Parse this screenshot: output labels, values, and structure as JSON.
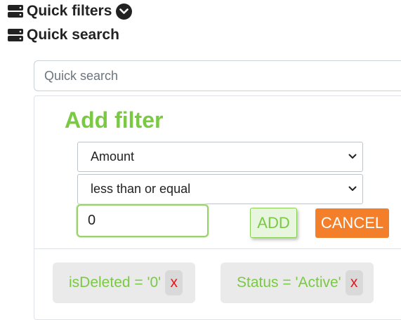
{
  "header": {
    "quick_filters_label": "Quick filters",
    "quick_search_label": "Quick search"
  },
  "search": {
    "placeholder": "Quick search",
    "value": ""
  },
  "add_filter": {
    "title": "Add filter",
    "field_selected": "Amount",
    "operator_selected": "less than or equal",
    "value": "0",
    "add_label": "ADD",
    "cancel_label": "CANCEL"
  },
  "active_filters": [
    {
      "label": "isDeleted = '0'",
      "remove": "x"
    },
    {
      "label": "Status = 'Active'",
      "remove": "x"
    }
  ],
  "colors": {
    "accent_green": "#7ac943",
    "cancel_orange": "#f47f2a",
    "remove_red": "#e4141b"
  },
  "icons": {
    "quick_filters": "database-icon",
    "toggle": "chevron-down-circle-icon",
    "quick_search": "database-icon"
  }
}
